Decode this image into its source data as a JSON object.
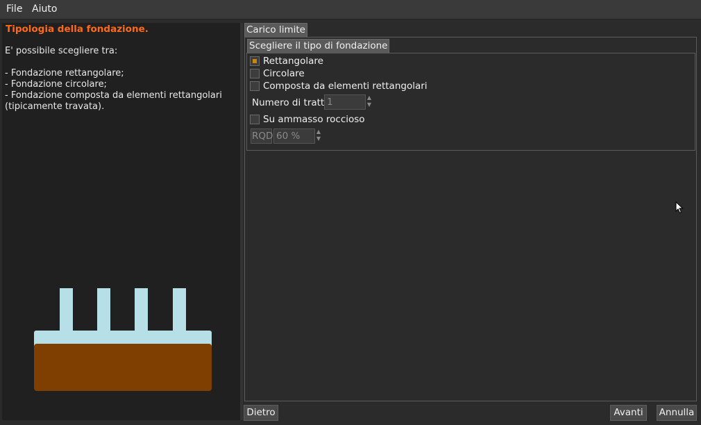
{
  "menu": {
    "file": "File",
    "help": "Aiuto"
  },
  "help_panel": {
    "title": "Tipologia della fondazione.",
    "lines": [
      "E' possibile scegliere tra:",
      "- Fondazione rettangolare;",
      "- Fondazione circolare;",
      "- Fondazione composta da elementi rettangolari",
      "(tipicamente travata)."
    ]
  },
  "tab": {
    "label": "Carico limite"
  },
  "group": {
    "title": "Scegliere il tipo di fondazione",
    "options": [
      {
        "label": "Rettangolare",
        "checked": true
      },
      {
        "label": "Circolare",
        "checked": false
      },
      {
        "label": "Composta da elementi rettangolari",
        "checked": false
      }
    ],
    "num_segments": {
      "label": "Numero di tratti",
      "value": "1"
    },
    "rock": {
      "label": "Su ammasso roccioso",
      "checked": false
    },
    "rqd": {
      "label": "RQD",
      "value": "60 %"
    }
  },
  "buttons": {
    "back": "Dietro",
    "next": "Avanti",
    "cancel": "Annulla"
  },
  "colors": {
    "title_accent": "#ff6a1a",
    "soil": "#7f3f00",
    "foundation": "#b6dfe8",
    "checkbox_mark": "#c8860b"
  }
}
